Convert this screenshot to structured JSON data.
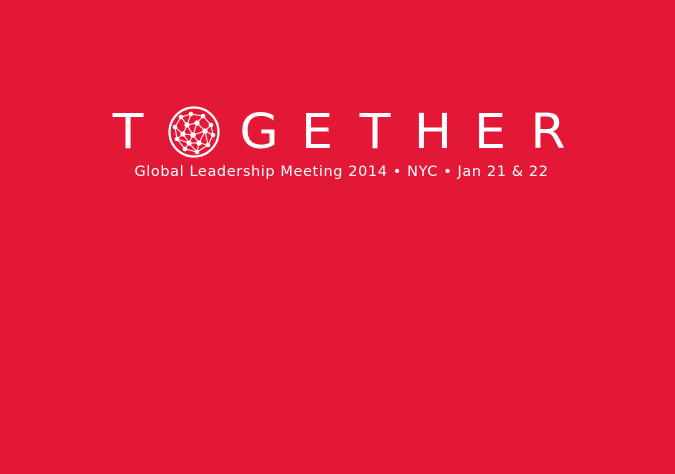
{
  "colors": {
    "background": "#E31837",
    "foreground": "#FFFFFF"
  },
  "logo": {
    "letters": [
      "T",
      "O",
      "G",
      "E",
      "T",
      "H",
      "E",
      "R"
    ],
    "globe_icon": "network-globe-icon"
  },
  "subtitle": "Global Leadership Meeting 2014 • NYC • Jan 21 & 22"
}
